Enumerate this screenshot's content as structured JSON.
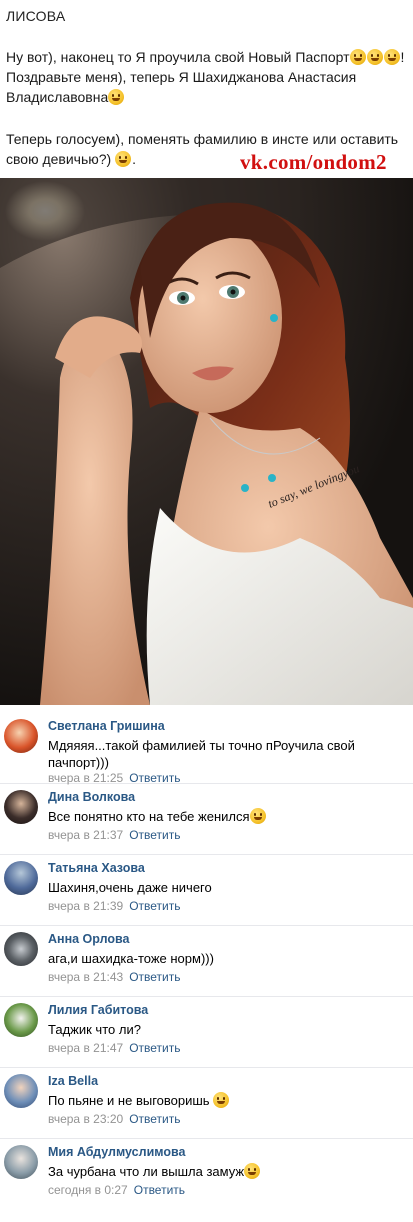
{
  "post": {
    "author": "ЛИСОВА",
    "paragraph1": "Ну вот), наконец то Я проучила свой Новый Паспорт",
    "paragraph1_tail": "! Поздравьте меня), теперь Я Шахиджанова Анастасия Владиславовна",
    "paragraph2": "Теперь голосуем), поменять фамилию в инсте или оставить свою девичью?)",
    "watermark": "vk.com/ondom2",
    "tattoo_text": "to say, we lovingyou"
  },
  "comments": [
    {
      "author": "Светлана Гришина",
      "text": "Мдяяяя...такой фамилией ты точно пРоучила свой пачпорт)))",
      "time": "вчера в 21:25",
      "reply": "Ответить",
      "avatar_color": "#d9542a"
    },
    {
      "author": "Дина Волкова",
      "text": "Все понятно кто на тебе женился",
      "time": "вчера в 21:37",
      "reply": "Ответить",
      "avatar_color": "#3b2d2a"
    },
    {
      "author": "Татьяна Хазова",
      "text": "Шахиня,очень даже ничего",
      "time": "вчера в 21:39",
      "reply": "Ответить",
      "avatar_color": "#4f6a9a"
    },
    {
      "author": "Анна Орлова",
      "text": "ага,и шахидка-тоже норм)))",
      "time": "вчера в 21:43",
      "reply": "Ответить",
      "avatar_color": "#5c6166"
    },
    {
      "author": "Лилия Габитова",
      "text": "Таджик что ли?",
      "time": "вчера в 21:47",
      "reply": "Ответить",
      "avatar_color": "#6b9a4a"
    },
    {
      "author": "Iza Bella",
      "text": "По пьяне и не выговоришь",
      "time": "вчера в 23:20",
      "reply": "Ответить",
      "avatar_color": "#6f8fb8"
    },
    {
      "author": "Мия Абдулмуслимова",
      "text": "За чурбана что ли вышла замуж",
      "time": "сегодня в 0:27",
      "reply": "Ответить",
      "avatar_color": "#8a9ca8"
    }
  ]
}
